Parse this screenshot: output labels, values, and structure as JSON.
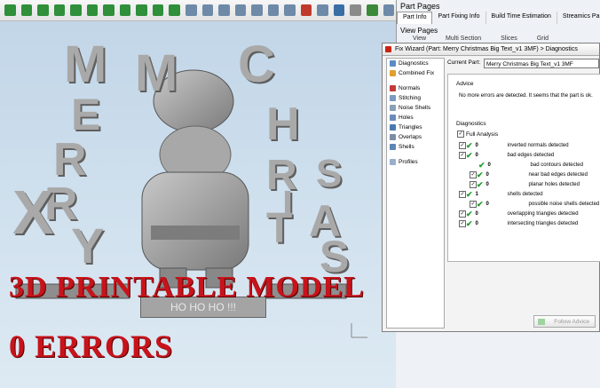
{
  "toolbar": {
    "icons": [
      "move-icon",
      "scale-icon",
      "mirror-icon",
      "section-icon",
      "measure-icon",
      "cut-icon",
      "pan-icon",
      "pick-icon",
      "rotate-icon",
      "color-icon",
      "cube-icon",
      "box-view-icon",
      "front-view-icon",
      "back-view-icon",
      "left-view-icon",
      "right-view-icon",
      "top-view-icon",
      "bottom-view-icon",
      "iso-view-icon",
      "wire-icon",
      "flag-icon",
      "shade-icon",
      "hide-icon",
      "light-icon"
    ],
    "colors": [
      "#2f8f3a",
      "#2f8f3a",
      "#2f8f3a",
      "#2f8f3a",
      "#2f8f3a",
      "#2f8f3a",
      "#2f8f3a",
      "#2f8f3a",
      "#2f8f3a",
      "#2f8f3a",
      "#2f8f3a",
      "#6e8aa8",
      "#6e8aa8",
      "#6e8aa8",
      "#6e8aa8",
      "#6e8aa8",
      "#6e8aa8",
      "#6e8aa8",
      "#c0392b",
      "#6e8aa8",
      "#3a6ea5",
      "#8a8a8a",
      "#3a8a3a",
      "#6e8aa8"
    ]
  },
  "model": {
    "letters": [
      "M",
      "E",
      "R",
      "R",
      "Y",
      "X",
      "M",
      "A",
      "S",
      "C",
      "H",
      "R",
      "I",
      "S",
      "T"
    ],
    "plate_text": "HO HO HO !!!",
    "overlay_line1": "3D PRINTABLE MODEL",
    "overlay_line2": "0 ERRORS"
  },
  "part_pages": {
    "title": "Part Pages",
    "tabs": [
      "Part Info",
      "Part Fixing Info",
      "Build Time Estimation",
      "Streamics Part Ta"
    ],
    "view_pages_title": "View Pages",
    "columns": [
      "View",
      "Multi Section",
      "Slices",
      "Grid"
    ]
  },
  "wizard": {
    "title": "Fix Wizard (Part: Merry Christmas Big Text_v1 3MF) > Diagnostics",
    "sidebar": [
      "Diagnostics",
      "Combined Fix",
      "Normals",
      "Stitching",
      "Noise Shells",
      "Holes",
      "Triangles",
      "Overlaps",
      "Shells",
      "Profiles"
    ],
    "current_part_label": "Current Part:",
    "current_part_value": "Merry Christmas Big Text_v1 3MF",
    "advice_label": "Advice",
    "advice_text": "No more errors are detected. It seems that the part is ok.",
    "diagnostics_label": "Diagnostics",
    "full_analysis_label": "Full Analysis",
    "rows": [
      {
        "count": "0",
        "label": "inverted normals detected"
      },
      {
        "count": "0",
        "label": "bad edges detected"
      },
      {
        "count": "0",
        "label": "bad contours detected"
      },
      {
        "count": "0",
        "label": "near bad edges detected"
      },
      {
        "count": "0",
        "label": "planar holes detected"
      },
      {
        "count": "1",
        "label": "shells detected"
      },
      {
        "count": "0",
        "label": "possible noise shells detected"
      },
      {
        "count": "0",
        "label": "overlapping triangles detected"
      },
      {
        "count": "0",
        "label": "intersecting triangles detected"
      }
    ],
    "follow_advice_label": "Follow Advice"
  }
}
